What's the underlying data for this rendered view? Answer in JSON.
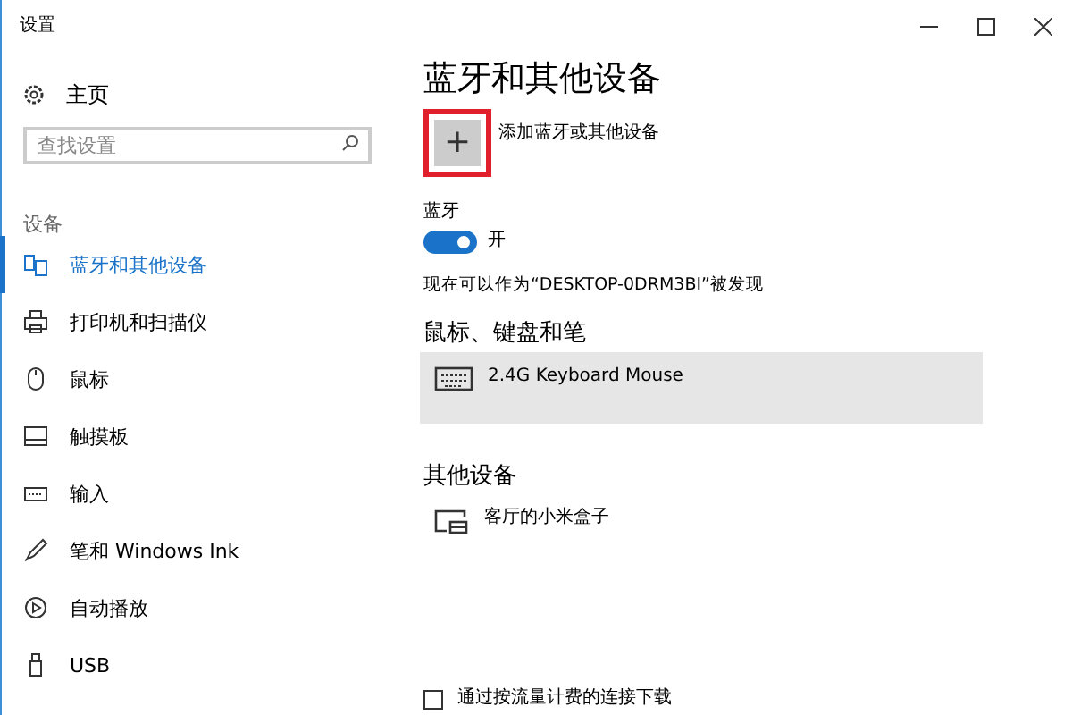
{
  "window": {
    "title": "设置",
    "controls": [
      {
        "kind": "minimize"
      },
      {
        "kind": "maximize"
      },
      {
        "kind": "close"
      }
    ]
  },
  "sidebar": {
    "home": "主页",
    "search": {
      "placeholder": "查找设置"
    },
    "section": "设备",
    "items": [
      {
        "label": "蓝牙和其他设备",
        "kind": "bluetooth",
        "selected": true
      },
      {
        "label": "打印机和扫描仪",
        "kind": "printer",
        "selected": false
      },
      {
        "label": "鼠标",
        "kind": "mouse",
        "selected": false
      },
      {
        "label": "触摸板",
        "kind": "touchpad",
        "selected": false
      },
      {
        "label": "输入",
        "kind": "keyboard",
        "selected": false
      },
      {
        "label": "笔和 Windows Ink",
        "kind": "pen",
        "selected": false
      },
      {
        "label": "自动播放",
        "kind": "autoplay",
        "selected": false
      },
      {
        "label": "USB",
        "kind": "usb",
        "selected": false
      }
    ]
  },
  "content": {
    "title": "蓝牙和其他设备",
    "add_button": {
      "symbol": "+",
      "label": "添加蓝牙或其他设备",
      "highlighted": true
    },
    "bluetooth": {
      "label": "蓝牙",
      "on": true,
      "state_text": "开",
      "discoverable": "现在可以作为“DESKTOP-0DRM3BI”被发现"
    },
    "groups": [
      {
        "heading": "鼠标、键盘和笔",
        "devices": [
          {
            "name": "2.4G Keyboard Mouse",
            "kind": "keyboard",
            "selected": true
          }
        ]
      },
      {
        "heading": "其他设备",
        "devices": [
          {
            "name": "客厅的小米盒子",
            "kind": "media",
            "selected": false
          }
        ]
      }
    ],
    "metered": {
      "label": "通过按流量计费的连接下载",
      "checked": false
    }
  }
}
